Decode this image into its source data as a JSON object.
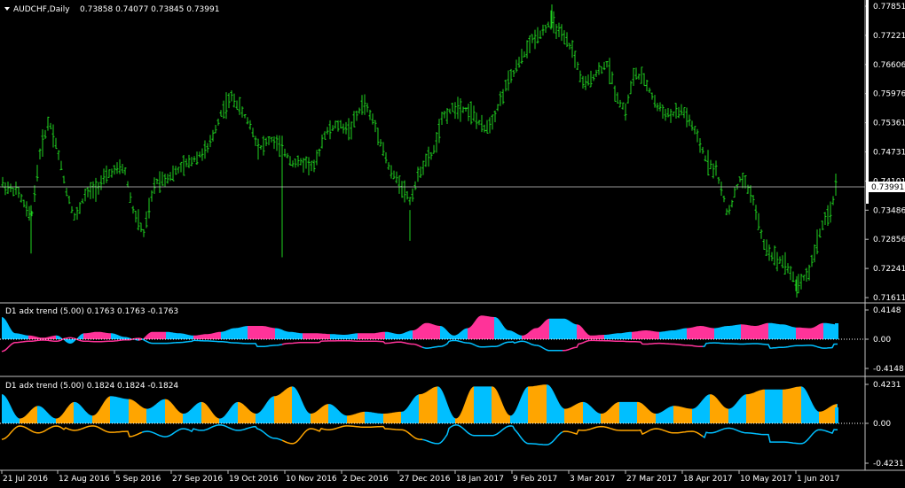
{
  "main": {
    "symbol": "AUDCHF,Daily",
    "ohlc": "0.73858 0.74077 0.73845 0.73991",
    "current_price": "0.73991",
    "price_ticks": [
      "0.77851",
      "0.77221",
      "0.76606",
      "0.75976",
      "0.75361",
      "0.74731",
      "0.74101",
      "0.73486",
      "0.72856",
      "0.72241",
      "0.71611"
    ]
  },
  "ind1": {
    "label": "D1 adx trend (5.00) 0.1763 0.1763 -0.1763",
    "ticks": [
      "0.4148",
      "0.00",
      "-0.4148"
    ]
  },
  "ind2": {
    "label": "D1 adx trend (5.00) 0.1824 0.1824 -0.1824",
    "ticks": [
      "0.4231",
      "0.00",
      "-0.4231"
    ]
  },
  "time_axis": [
    "21 Jul 2016",
    "12 Aug 2016",
    "5 Sep 2016",
    "27 Sep 2016",
    "19 Oct 2016",
    "10 Nov 2016",
    "2 Dec 2016",
    "27 Dec 2016",
    "18 Jan 2017",
    "9 Feb 2017",
    "3 Mar 2017",
    "27 Mar 2017",
    "18 Apr 2017",
    "10 May 2017",
    "1 Jun 2017"
  ],
  "colors": {
    "bars": "#1fd21f",
    "cyan": "#00bfff",
    "magenta": "#ff3399",
    "orange": "#ffa500",
    "grid": "#ffffff"
  },
  "chart_data": [
    {
      "type": "ohlc",
      "title": "AUDCHF,Daily",
      "x_range": [
        "21 Jul 2016",
        "12 Jun 2017"
      ],
      "ylim": [
        0.7161,
        0.7785
      ],
      "close_path": [
        [
          0,
          0.741
        ],
        [
          10,
          0.7395
        ],
        [
          20,
          0.739
        ],
        [
          35,
          0.733
        ],
        [
          45,
          0.747
        ],
        [
          55,
          0.754
        ],
        [
          62,
          0.75
        ],
        [
          75,
          0.739
        ],
        [
          85,
          0.733
        ],
        [
          95,
          0.738
        ],
        [
          110,
          0.74
        ],
        [
          125,
          0.743
        ],
        [
          140,
          0.744
        ],
        [
          150,
          0.735
        ],
        [
          162,
          0.73
        ],
        [
          175,
          0.741
        ],
        [
          190,
          0.742
        ],
        [
          205,
          0.744
        ],
        [
          220,
          0.746
        ],
        [
          235,
          0.748
        ],
        [
          250,
          0.756
        ],
        [
          262,
          0.759
        ],
        [
          272,
          0.756
        ],
        [
          282,
          0.753
        ],
        [
          292,
          0.748
        ],
        [
          305,
          0.75
        ],
        [
          318,
          0.748
        ],
        [
          330,
          0.745
        ],
        [
          345,
          0.745
        ],
        [
          355,
          0.744
        ],
        [
          365,
          0.751
        ],
        [
          380,
          0.753
        ],
        [
          395,
          0.752
        ],
        [
          410,
          0.758
        ],
        [
          425,
          0.752
        ],
        [
          440,
          0.743
        ],
        [
          450,
          0.741
        ],
        [
          462,
          0.737
        ],
        [
          475,
          0.744
        ],
        [
          488,
          0.747
        ],
        [
          500,
          0.755
        ],
        [
          515,
          0.757
        ],
        [
          530,
          0.756
        ],
        [
          545,
          0.752
        ],
        [
          555,
          0.754
        ],
        [
          570,
          0.761
        ],
        [
          585,
          0.766
        ],
        [
          600,
          0.771
        ],
        [
          612,
          0.773
        ],
        [
          622,
          0.775
        ],
        [
          632,
          0.772
        ],
        [
          645,
          0.769
        ],
        [
          658,
          0.761
        ],
        [
          672,
          0.764
        ],
        [
          685,
          0.766
        ],
        [
          695,
          0.759
        ],
        [
          705,
          0.756
        ],
        [
          715,
          0.764
        ],
        [
          728,
          0.762
        ],
        [
          740,
          0.757
        ],
        [
          755,
          0.755
        ],
        [
          770,
          0.756
        ],
        [
          782,
          0.752
        ],
        [
          795,
          0.746
        ],
        [
          808,
          0.743
        ],
        [
          820,
          0.734
        ],
        [
          835,
          0.742
        ],
        [
          848,
          0.738
        ],
        [
          860,
          0.728
        ],
        [
          872,
          0.725
        ],
        [
          885,
          0.724
        ],
        [
          898,
          0.719
        ],
        [
          912,
          0.722
        ],
        [
          925,
          0.731
        ],
        [
          935,
          0.734
        ],
        [
          942,
          0.7399
        ]
      ]
    },
    {
      "type": "area",
      "title": "D1 adx trend (5.00) 0.1763 0.1763 -0.1763",
      "ylim": [
        -0.4148,
        0.4148
      ],
      "series": [
        {
          "values": [
            0.3,
            0.08,
            0.05,
            0.02,
            0.05,
            -0.06,
            0.08,
            0.1,
            0.08,
            0.03,
            -0.02,
            0.1,
            0.1,
            0.08,
            0.05,
            0.07,
            0.1,
            0.15,
            0.18,
            0.18,
            0.15,
            0.1,
            0.08,
            0.08,
            0.07,
            0.06,
            0.08,
            0.08,
            0.1,
            0.07,
            0.12,
            0.22,
            0.18,
            0.05,
            0.15,
            0.32,
            0.3,
            0.12,
            0.05,
            0.15,
            0.28,
            0.28,
            0.2,
            0.05,
            0.06,
            0.08,
            0.1,
            0.12,
            0.1,
            0.12,
            0.15,
            0.18,
            0.15,
            0.18,
            0.2,
            0.18,
            0.22,
            0.2,
            0.16,
            0.15,
            0.22,
            0.2
          ]
        }
      ]
    },
    {
      "type": "area",
      "title": "D1 adx trend (5.00) 0.1824 0.1824 -0.1824",
      "ylim": [
        -0.4231,
        0.4231
      ],
      "series": [
        {
          "values": [
            0.3,
            0.05,
            0.18,
            0.05,
            0.22,
            0.08,
            0.28,
            0.25,
            0.15,
            0.25,
            0.1,
            0.22,
            0.05,
            0.22,
            0.1,
            0.28,
            0.38,
            0.1,
            0.2,
            0.08,
            0.12,
            0.1,
            0.12,
            0.3,
            0.38,
            0.05,
            0.38,
            0.38,
            0.08,
            0.38,
            0.4,
            0.15,
            0.22,
            0.1,
            0.22,
            0.22,
            0.1,
            0.18,
            0.15,
            0.3,
            0.15,
            0.3,
            0.35,
            0.35,
            0.38,
            0.12,
            0.2
          ]
        }
      ]
    }
  ]
}
